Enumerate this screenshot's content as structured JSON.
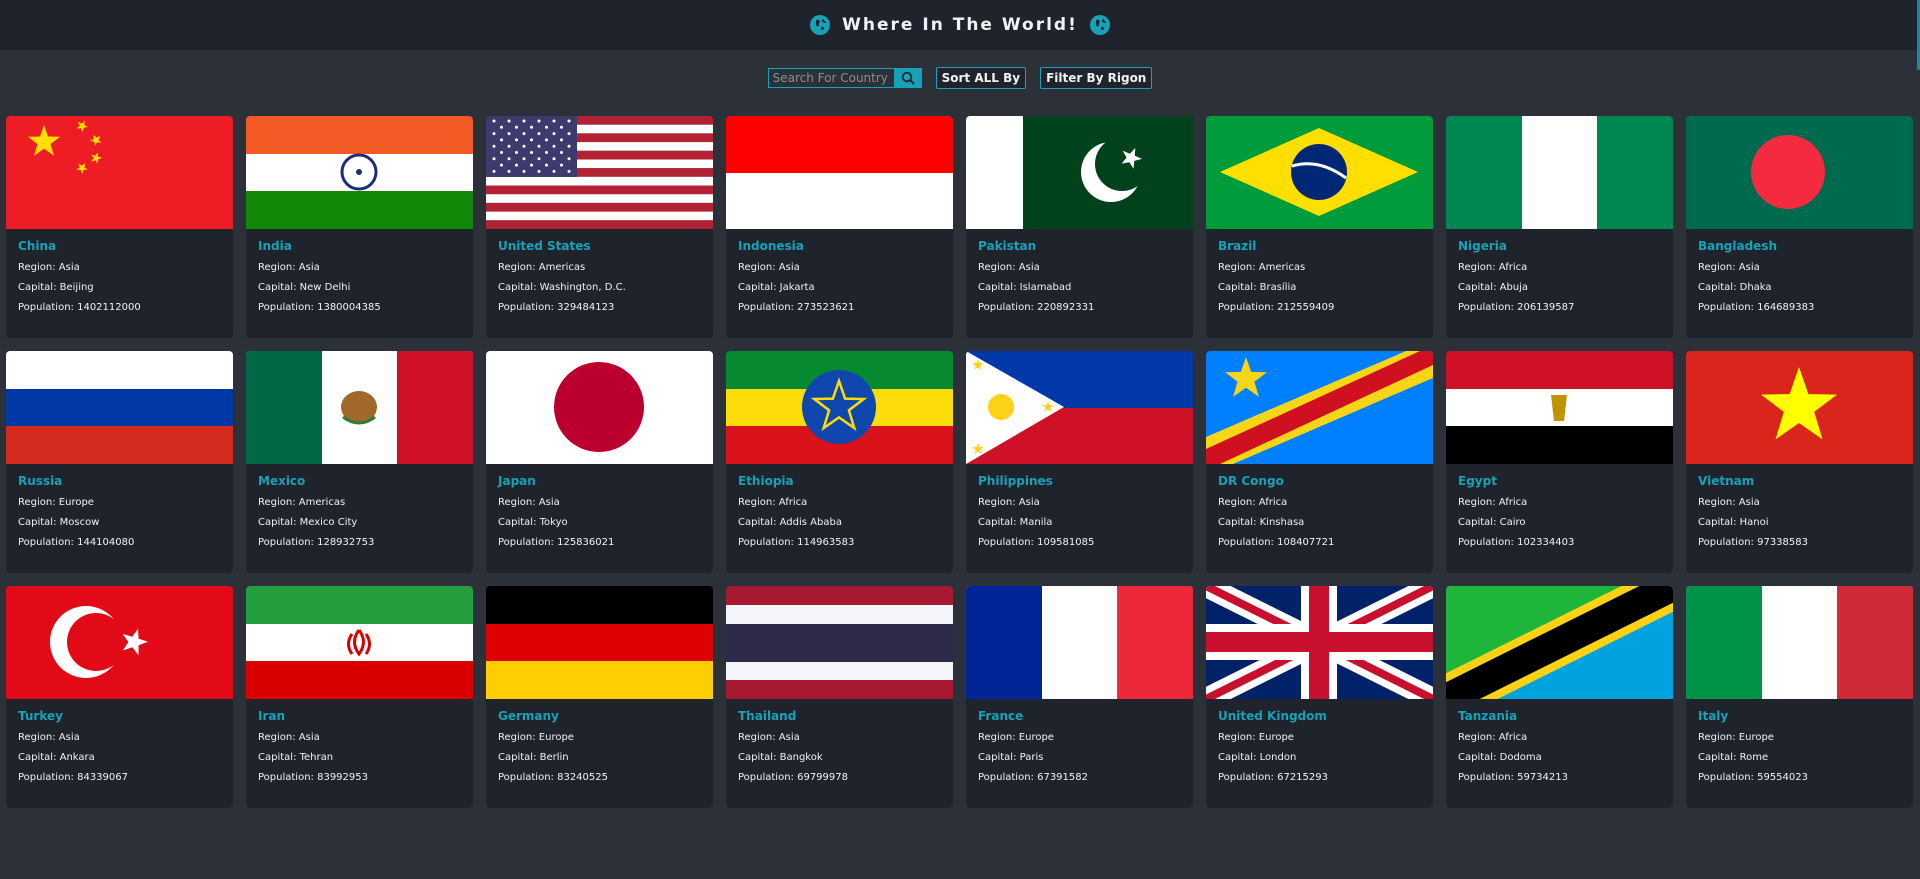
{
  "header": {
    "title": "Where In The World!"
  },
  "controls": {
    "search_placeholder": "Search For Country",
    "sort_label": "Sort ALL By",
    "filter_label": "Filter By Rigon"
  },
  "labels": {
    "region": "Region: ",
    "capital": "Capital: ",
    "population": "Population: "
  },
  "countries": [
    {
      "name": "China",
      "region": "Asia",
      "capital": "Beijing",
      "population": "1402112000"
    },
    {
      "name": "India",
      "region": "Asia",
      "capital": "New Delhi",
      "population": "1380004385"
    },
    {
      "name": "United States",
      "region": "Americas",
      "capital": "Washington, D.C.",
      "population": "329484123"
    },
    {
      "name": "Indonesia",
      "region": "Asia",
      "capital": "Jakarta",
      "population": "273523621"
    },
    {
      "name": "Pakistan",
      "region": "Asia",
      "capital": "Islamabad",
      "population": "220892331"
    },
    {
      "name": "Brazil",
      "region": "Americas",
      "capital": "Brasília",
      "population": "212559409"
    },
    {
      "name": "Nigeria",
      "region": "Africa",
      "capital": "Abuja",
      "population": "206139587"
    },
    {
      "name": "Bangladesh",
      "region": "Asia",
      "capital": "Dhaka",
      "population": "164689383"
    },
    {
      "name": "Russia",
      "region": "Europe",
      "capital": "Moscow",
      "population": "144104080"
    },
    {
      "name": "Mexico",
      "region": "Americas",
      "capital": "Mexico City",
      "population": "128932753"
    },
    {
      "name": "Japan",
      "region": "Asia",
      "capital": "Tokyo",
      "population": "125836021"
    },
    {
      "name": "Ethiopia",
      "region": "Africa",
      "capital": "Addis Ababa",
      "population": "114963583"
    },
    {
      "name": "Philippines",
      "region": "Asia",
      "capital": "Manila",
      "population": "109581085"
    },
    {
      "name": "DR Congo",
      "region": "Africa",
      "capital": "Kinshasa",
      "population": "108407721"
    },
    {
      "name": "Egypt",
      "region": "Africa",
      "capital": "Cairo",
      "population": "102334403"
    },
    {
      "name": "Vietnam",
      "region": "Asia",
      "capital": "Hanoi",
      "population": "97338583"
    },
    {
      "name": "Turkey",
      "region": "Asia",
      "capital": "Ankara",
      "population": "84339067"
    },
    {
      "name": "Iran",
      "region": "Asia",
      "capital": "Tehran",
      "population": "83992953"
    },
    {
      "name": "Germany",
      "region": "Europe",
      "capital": "Berlin",
      "population": "83240525"
    },
    {
      "name": "Thailand",
      "region": "Asia",
      "capital": "Bangkok",
      "population": "69799978"
    },
    {
      "name": "France",
      "region": "Europe",
      "capital": "Paris",
      "population": "67391582"
    },
    {
      "name": "United Kingdom",
      "region": "Europe",
      "capital": "London",
      "population": "67215293"
    },
    {
      "name": "Tanzania",
      "region": "Africa",
      "capital": "Dodoma",
      "population": "59734213"
    },
    {
      "name": "Italy",
      "region": "Europe",
      "capital": "Rome",
      "population": "59554023"
    }
  ],
  "colors": {
    "accent": "#17a2b8",
    "card": "#1f242c",
    "bg": "#2b3039"
  }
}
